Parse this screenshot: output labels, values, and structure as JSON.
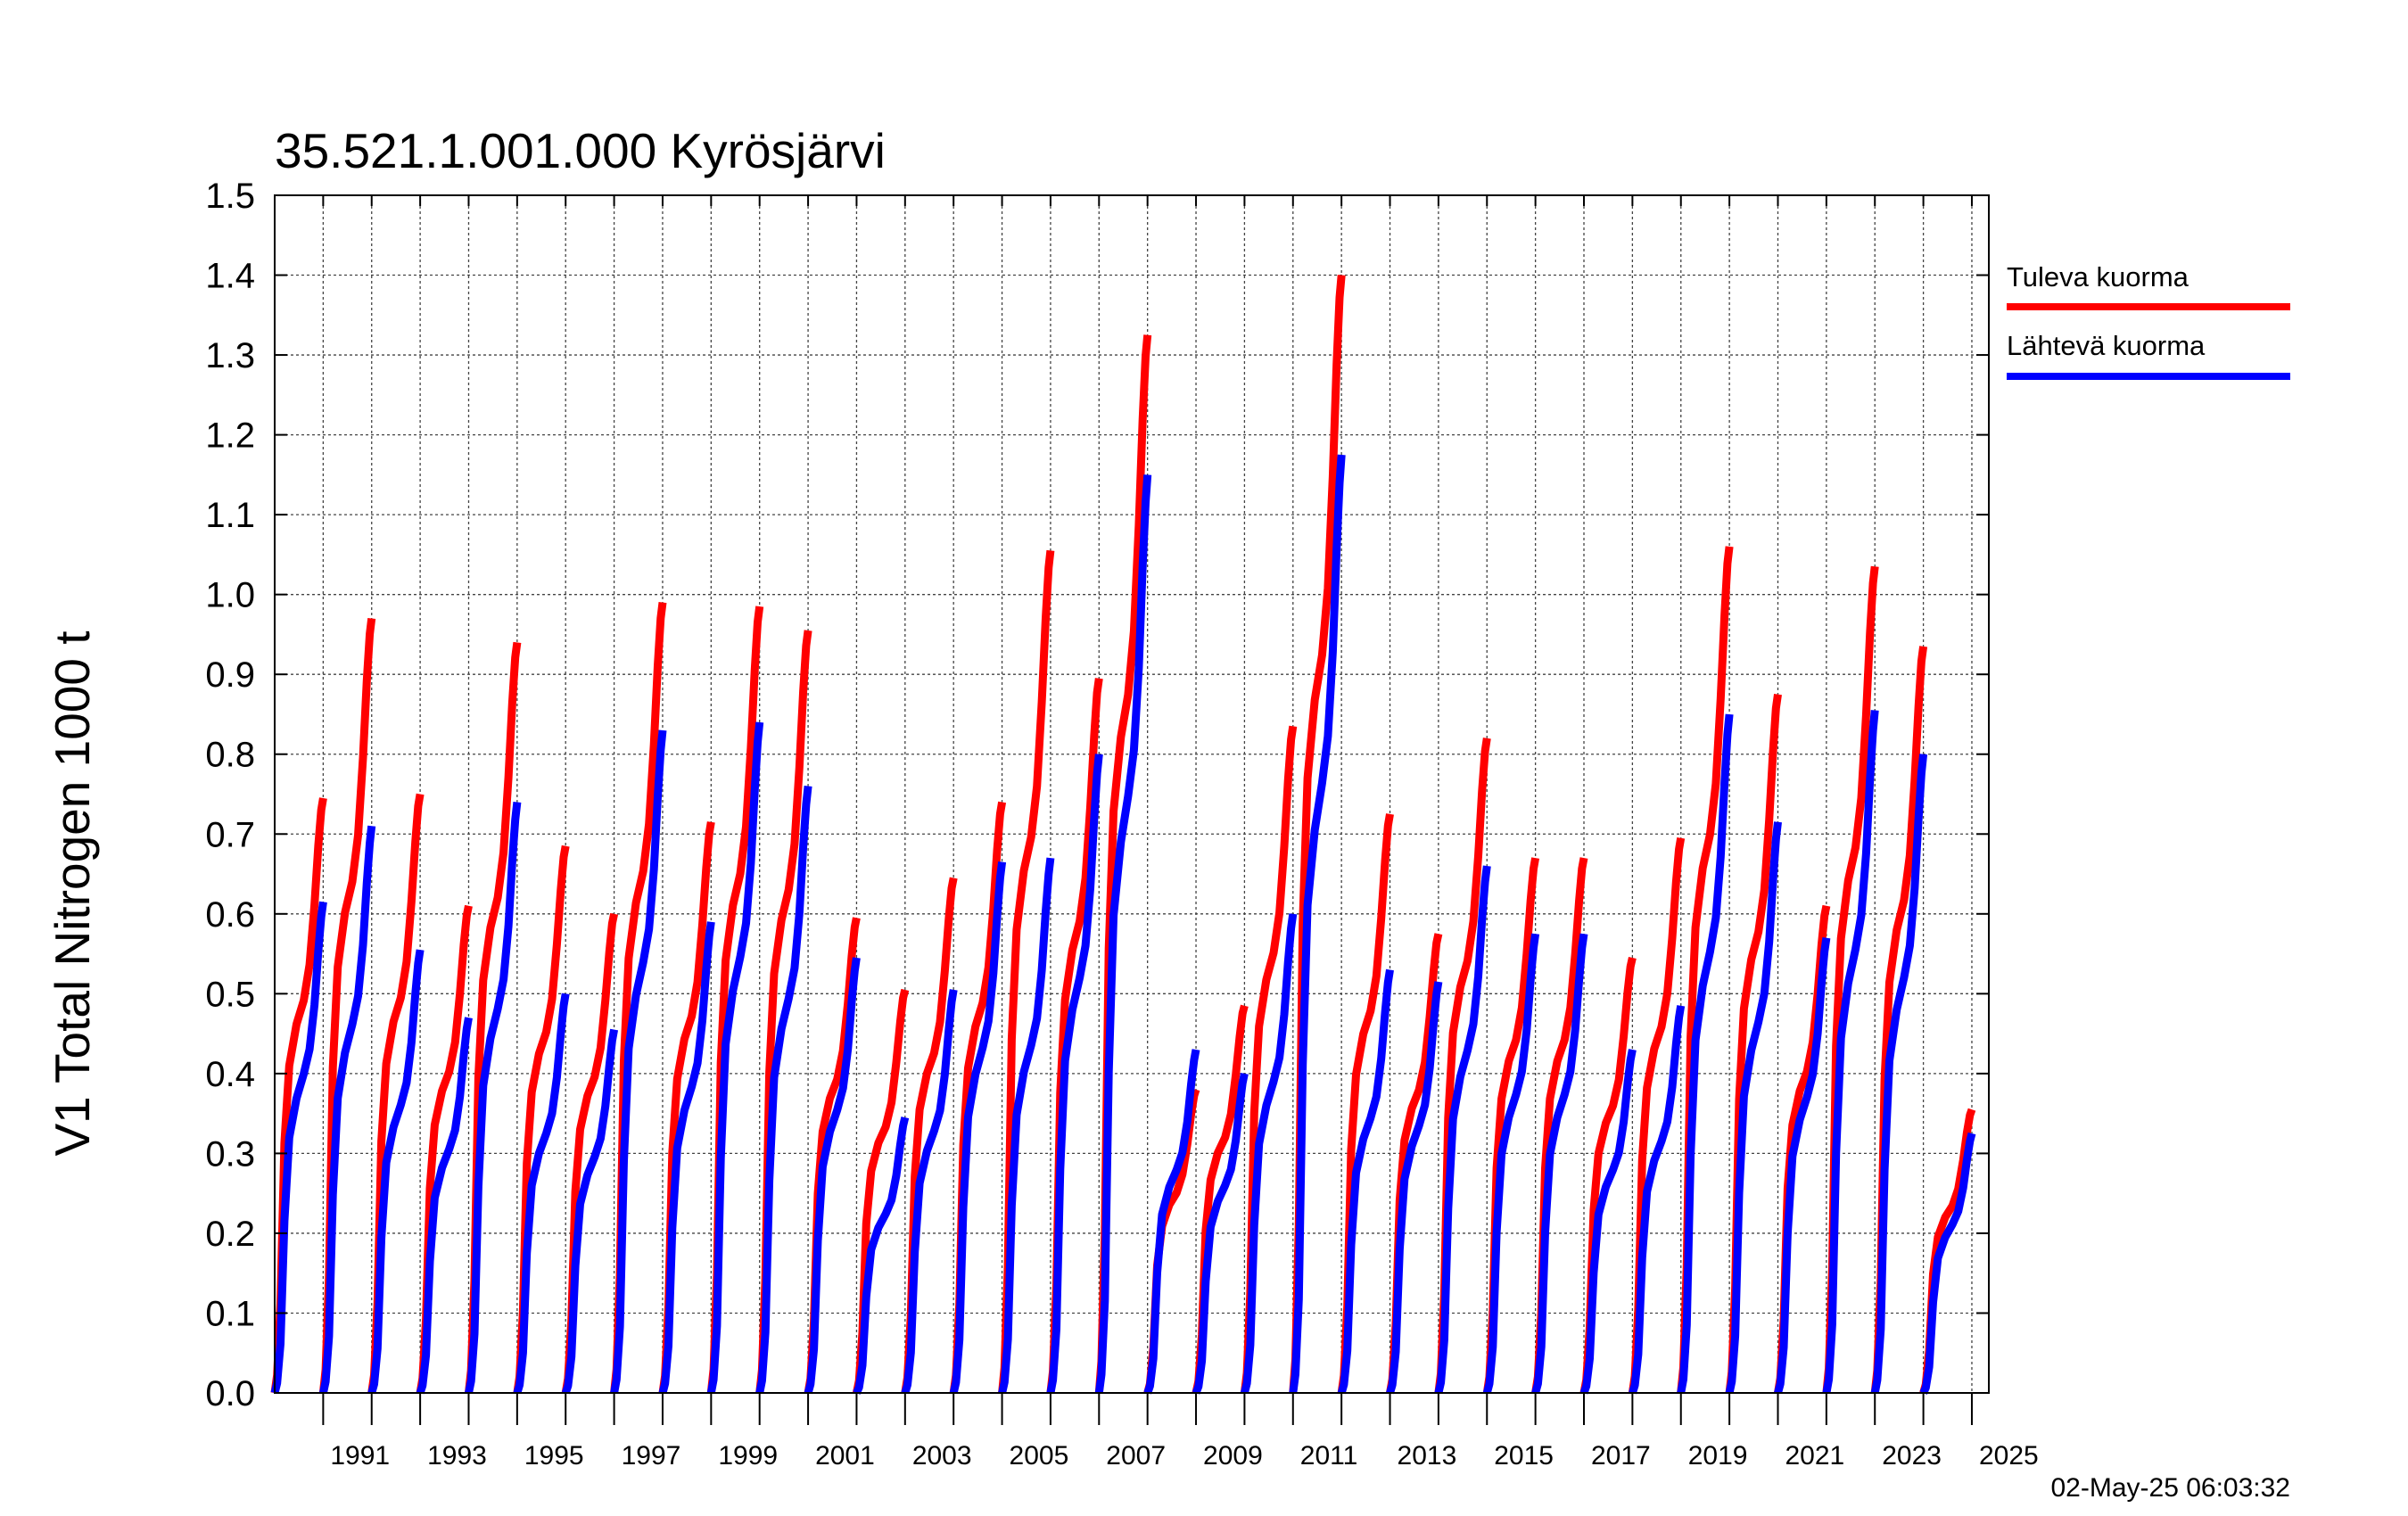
{
  "chart_data": {
    "type": "line",
    "title": "35.521.1.001.000 Kyrösjärvi",
    "ylabel": "V1 Total Nitrogen 1000 t",
    "ylim": [
      0,
      1.5
    ],
    "yticks": [
      "0.0",
      "0.1",
      "0.2",
      "0.3",
      "0.4",
      "0.5",
      "0.6",
      "0.7",
      "0.8",
      "0.9",
      "1.0",
      "1.1",
      "1.2",
      "1.3",
      "1.4",
      "1.5"
    ],
    "xlim": [
      1990,
      2025.35
    ],
    "xtick_labels": [
      {
        "x": 1991,
        "label": "1991"
      },
      {
        "x": 1993,
        "label": "1993"
      },
      {
        "x": 1995,
        "label": "1995"
      },
      {
        "x": 1997,
        "label": "1997"
      },
      {
        "x": 1999,
        "label": "1999"
      },
      {
        "x": 2001,
        "label": "2001"
      },
      {
        "x": 2003,
        "label": "2003"
      },
      {
        "x": 2005,
        "label": "2005"
      },
      {
        "x": 2007,
        "label": "2007"
      },
      {
        "x": 2009,
        "label": "2009"
      },
      {
        "x": 2011,
        "label": "2011"
      },
      {
        "x": 2013,
        "label": "2013"
      },
      {
        "x": 2015,
        "label": "2015"
      },
      {
        "x": 2017,
        "label": "2017"
      },
      {
        "x": 2019,
        "label": "2019"
      },
      {
        "x": 2021,
        "label": "2021"
      },
      {
        "x": 2023,
        "label": "2023"
      },
      {
        "x": 2025,
        "label": "2025"
      }
    ],
    "grid": true,
    "legend_position": "right",
    "timestamp": "02-May-25 06:03:32",
    "series": [
      {
        "name": "Tuleva kuorma",
        "color": "#ff0000",
        "annual_totals": [
          0.745,
          0.97,
          0.75,
          0.61,
          0.94,
          0.685,
          0.6,
          0.99,
          0.715,
          0.985,
          0.955,
          0.595,
          0.505,
          0.645,
          0.74,
          1.055,
          0.895,
          1.325,
          0.38,
          0.485,
          0.835,
          1.4,
          0.725,
          0.575,
          0.82,
          0.67,
          0.67,
          0.545,
          0.695,
          1.06,
          0.875,
          0.61,
          1.035,
          0.935,
          0.355
        ]
      },
      {
        "name": "Lähtevä kuorma",
        "color": "#0000ff",
        "annual_totals": [
          0.615,
          0.71,
          0.555,
          0.47,
          0.74,
          0.5,
          0.455,
          0.83,
          0.59,
          0.84,
          0.76,
          0.545,
          0.345,
          0.505,
          0.665,
          0.67,
          0.8,
          1.15,
          0.43,
          0.4,
          0.6,
          1.175,
          0.53,
          0.515,
          0.66,
          0.575,
          0.575,
          0.43,
          0.485,
          0.85,
          0.715,
          0.57,
          0.855,
          0.8,
          0.325
        ]
      }
    ]
  }
}
